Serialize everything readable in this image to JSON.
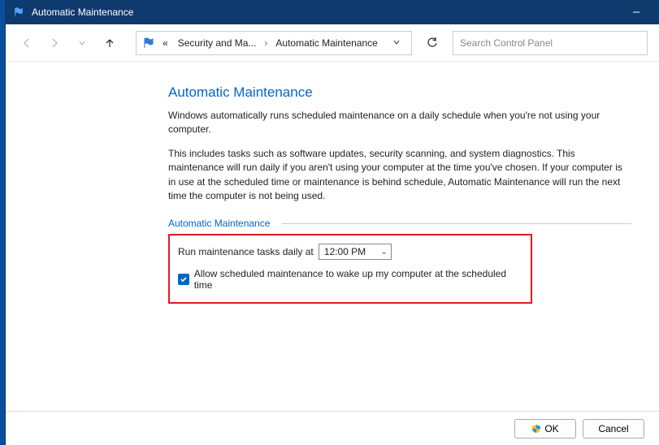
{
  "titlebar": {
    "title": "Automatic Maintenance"
  },
  "breadcrumb": {
    "prefix": "«",
    "seg1": "Security and Ma...",
    "seg2": "Automatic Maintenance"
  },
  "search": {
    "placeholder": "Search Control Panel"
  },
  "page": {
    "title": "Automatic Maintenance",
    "para1": "Windows automatically runs scheduled maintenance on a daily schedule when you're not using your computer.",
    "para2": "This includes tasks such as software updates, security scanning, and system diagnostics. This maintenance will run daily if you aren't using your computer at the time you've chosen. If your computer is in use at the scheduled time or maintenance is behind schedule, Automatic Maintenance will run the next time the computer is not being used.",
    "section_header": "Automatic Maintenance",
    "run_label": "Run maintenance tasks daily at",
    "time_value": "12:00 PM",
    "checkbox_label": "Allow scheduled maintenance to wake up my computer at the scheduled time",
    "checkbox_checked": true
  },
  "footer": {
    "ok": "OK",
    "cancel": "Cancel"
  }
}
